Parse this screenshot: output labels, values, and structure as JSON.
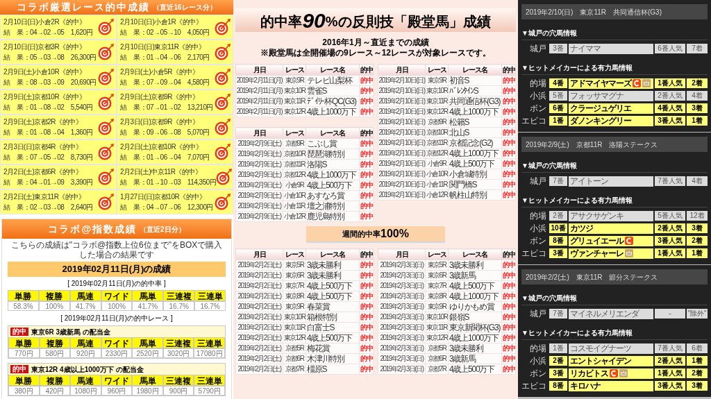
{
  "selected_races": {
    "title": "コラボ厳選レース的中成績",
    "note": "（直近16レース分）",
    "items": [
      {
        "title": "2月10日(日)小倉2R《的中》",
        "result": "結　果：04→02→05　1,620円"
      },
      {
        "title": "2月10日(日)小倉1R《的中》",
        "result": "結　果：02→05→10　4,050円"
      },
      {
        "title": "2月10日(日)京都3R《的中》",
        "result": "結　果：05→03→08　26,300円"
      },
      {
        "title": "2月10日(日)東京11R《的中》",
        "result": "結　果：01→04→06　2,170円"
      },
      {
        "title": "2月9日(土)小倉10R《的中》",
        "result": "結　果：08→03→09　20,690円"
      },
      {
        "title": "2月9日(土)小倉5R《的中》",
        "result": "結　果：07→09→04　4,580円"
      },
      {
        "title": "2月9日(土)京都10R《的中》",
        "result": "結　果：01→08→02　5,540円"
      },
      {
        "title": "2月9日(土)京都9R《的中》",
        "result": "結　果：07→01→02　13,210円"
      },
      {
        "title": "2月9日(土)京都2R《的中》",
        "result": "結　果：01→08→04　1,360円"
      },
      {
        "title": "2月3日(日)京都9R《的中》",
        "result": "結　果：09→06→08　5,070円"
      },
      {
        "title": "2月3日(日)京都4R《的中》",
        "result": "結　果：07→05→02　8,730円"
      },
      {
        "title": "2月2日(土)京都10R《的中》",
        "result": "結　果：01→06→04　7,070円"
      },
      {
        "title": "2月2日(土)京都6R《的中》",
        "result": "結　果：04→01→09　3,390円"
      },
      {
        "title": "2月2日(土)中京11R《的中》",
        "result": "結　果：01→10→03　114,350円"
      },
      {
        "title": "2月2日(土)東京11R《的中》",
        "result": "結　果：02→03→08　2,640円"
      },
      {
        "title": "1月27日(日)京都10R《的中》",
        "result": "結　果：04→07→06　12,300円"
      }
    ]
  },
  "index_results": {
    "title": "コラボ@指数成績",
    "note": "（直近2日分）",
    "description": "こちらの成績は\"コラボ@指数上位6位まで\"をBOXで購入した場合の結果です",
    "date_banner": "2019年02月11日(月)の成績",
    "rates_label": "[ 2019年02月11日(月)の的中率 ]",
    "columns": [
      "単勝",
      "複勝",
      "馬連",
      "ワイド",
      "馬単",
      "三連複",
      "三連単"
    ],
    "rates": [
      "58.3%",
      "100%",
      "41.7%",
      "100%",
      "41.7%",
      "16.7%",
      "16.7%"
    ],
    "races_label": "[ 2019年02月11日(月)の的中レース ]",
    "races": [
      {
        "badge": "的中",
        "title": "東京6R 3歳新馬 の配当金",
        "columns": [
          "単勝",
          "複勝",
          "馬連",
          "ワイド",
          "馬単",
          "三連複",
          "三連単"
        ],
        "values": [
          "770円",
          "580円",
          "920円",
          "2330円",
          "2520円",
          "3020円",
          "17080円"
        ]
      },
      {
        "badge": "的中",
        "title": "東京12R 4歳以上1000万下 の配当金",
        "columns": [
          "単勝",
          "複勝",
          "馬連",
          "ワイド",
          "馬単",
          "三連複",
          "三連単"
        ],
        "values": [
          "380円",
          "420円",
          "1080円",
          "960円",
          "1980円",
          "900円",
          "5790円"
        ]
      }
    ]
  },
  "hall_of_fame": {
    "title_before": "的中率",
    "title_number": "90",
    "title_after": "%の反則技「殿堂馬」成績",
    "subtitle": [
      "2016年1月～直近までの成績",
      "※殿堂馬は全開催場の9レース～12レースが対象レースです。"
    ],
    "top_columns": [
      {
        "tables": [
          {
            "columns": [
              "月日",
              "レース",
              "レース名",
              "的中"
            ],
            "rows": [
              [
                "2019年2月11日(月)",
                "東京9R",
                "テレビ山梨杯",
                "的中"
              ],
              [
                "2019年2月11日(月)",
                "東京10R",
                "雲雀S",
                "的中"
              ],
              [
                "2019年2月11日(月)",
                "東京11R",
                "ﾃﾞｲﾘｰ杯QC(G3)",
                "的中"
              ],
              [
                "2019年2月11日(月)",
                "東京12R",
                "4歳上1000万下",
                "的中"
              ]
            ]
          },
          {
            "columns": [
              "月日",
              "レース",
              "レース名",
              "的中"
            ],
            "rows": [
              [
                "2019年2月9日(土)",
                "京都9R",
                "こぶし賞",
                "的中"
              ],
              [
                "2019年2月9日(土)",
                "京都10R",
                "琵琶湖特別",
                "的中"
              ],
              [
                "2019年2月9日(土)",
                "京都11R",
                "洛陽S",
                "的中"
              ],
              [
                "2019年2月9日(土)",
                "京都12R",
                "4歳上1000万下",
                "的中"
              ],
              [
                "2019年2月9日(土)",
                "小倉9R",
                "4歳上500万下",
                "的中"
              ],
              [
                "2019年2月9日(土)",
                "小倉10R",
                "あすなろ賞",
                "的中"
              ],
              [
                "2019年2月9日(土)",
                "小倉11R",
                "壇之浦特別",
                "的中"
              ],
              [
                "2019年2月9日(土)",
                "小倉12R",
                "鹿児島特別",
                "的中"
              ]
            ]
          }
        ]
      },
      {
        "tables": [
          {
            "columns": [
              "月日",
              "レース",
              "レース名",
              "的中"
            ],
            "rows": [
              [
                "2019年2月10日(日)",
                "東京9R",
                "初音S",
                "的中"
              ],
              [
                "2019年2月10日(日)",
                "東京10R",
                "ﾊﾞﾚﾝﾀｲﾝS",
                "的中"
              ],
              [
                "2019年2月10日(日)",
                "東京11R",
                "共同通信杯(G3)",
                "的中"
              ],
              [
                "2019年2月10日(日)",
                "東京12R",
                "4歳上1000万下",
                "的中"
              ],
              [
                "2019年2月10日(日)",
                "京都9R",
                "松籟S",
                "的中"
              ],
              [
                "2019年2月10日(日)",
                "京都10R",
                "北山S",
                "的中"
              ],
              [
                "2019年2月10日(日)",
                "京都11R",
                "京都記念(G2)",
                "的中"
              ],
              [
                "2019年2月10日(日)",
                "京都12R",
                "4歳上1000万下",
                "的中"
              ],
              [
                "2019年2月10日(日)",
                "小倉9R",
                "4歳上500万下",
                "的中"
              ],
              [
                "2019年2月10日(日)",
                "小倉10R",
                "小倉城特別",
                "的中"
              ],
              [
                "2019年2月10日(日)",
                "小倉11R",
                "関門橋S",
                "的中"
              ],
              [
                "2019年2月10日(日)",
                "小倉12R",
                "帆柱山特別",
                "的中"
              ]
            ]
          }
        ]
      }
    ],
    "weekly_before": "週間的中率",
    "weekly_number": "100%",
    "bottom_tables": [
      {
        "columns": [
          "月日",
          "レース",
          "レース名",
          "的中"
        ],
        "rows": [
          [
            "2019年2月2日(土)",
            "東京5R",
            "3歳未勝利",
            "的中"
          ],
          [
            "2019年2月2日(土)",
            "東京6R",
            "3歳未勝利",
            "的中"
          ],
          [
            "2019年2月2日(土)",
            "東京7R",
            "4歳上500万下",
            "的中"
          ],
          [
            "2019年2月2日(土)",
            "東京8R",
            "4歳上500万下",
            "的中"
          ],
          [
            "2019年2月2日(土)",
            "東京9R",
            "春菜賞",
            "的中"
          ],
          [
            "2019年2月2日(土)",
            "東京10R",
            "箱根特別",
            "的中"
          ],
          [
            "2019年2月2日(土)",
            "東京11R",
            "白富士S",
            "的中"
          ],
          [
            "2019年2月2日(土)",
            "東京12R",
            "4歳上500万下",
            "的中"
          ],
          [
            "2019年2月2日(土)",
            "京都5R",
            "梅花賞",
            "的中"
          ],
          [
            "2019年2月2日(土)",
            "京都6R",
            "木津川特別",
            "的中"
          ],
          [
            "2019年2月2日(土)",
            "京都7R",
            "橿原S",
            "的中"
          ]
        ]
      },
      {
        "columns": [
          "月日",
          "レース",
          "レース名",
          "的中"
        ],
        "rows": [
          [
            "2019年2月3日(日)",
            "東京5R",
            "3歳未勝利",
            "的中"
          ],
          [
            "2019年2月3日(日)",
            "東京6R",
            "3歳新馬",
            "的中"
          ],
          [
            "2019年2月3日(日)",
            "東京7R",
            "4歳上500万下",
            "的中"
          ],
          [
            "2019年2月3日(日)",
            "東京8R",
            "4歳上1000万下",
            "的中"
          ],
          [
            "2019年2月3日(日)",
            "東京9R",
            "ゆりかもめ賞",
            "的中"
          ],
          [
            "2019年2月3日(日)",
            "東京10R",
            "銀嶺S",
            "的中"
          ],
          [
            "2019年2月3日(日)",
            "東京11R",
            "東京新聞杯(G3)",
            "的中"
          ],
          [
            "2019年2月3日(日)",
            "東京12R",
            "4歳上1000万下",
            "的中"
          ],
          [
            "2019年2月3日(日)",
            "京都5R",
            "3歳未勝利",
            "的中"
          ],
          [
            "2019年2月3日(日)",
            "京都6R",
            "3歳新馬",
            "的中"
          ],
          [
            "2019年2月3日(日)",
            "京都7R",
            "4歳上500万下",
            "的中"
          ]
        ]
      }
    ]
  },
  "race_panels": [
    {
      "header": [
        "2019年2/10(日)",
        "東京11R",
        "共同通信杯(G3)"
      ],
      "pick_label": "▼城戸の穴馬情報",
      "pick": {
        "label": "城戸",
        "number": "3番",
        "horse": "ナイママ",
        "popularity": "6番人気",
        "placing": "7着",
        "hit": false
      },
      "makers_label": "▼ヒットメイカーによる有力馬情報",
      "rows": [
        {
          "label": "的場",
          "number": "4番",
          "horse": "アドマイヤマーズ",
          "badges": [
            {
              "kind": "c"
            },
            {
              "kind": "crown"
            }
          ],
          "popularity": "1番人気",
          "placing": "2着",
          "hit": true
        },
        {
          "label": "小浜",
          "number": "5番",
          "horse": "フォッサマグナ",
          "popularity": "2番人気",
          "placing": "4着",
          "hit": false
        },
        {
          "label": "ボン",
          "number": "6番",
          "horse": "クラージュゲリエ",
          "popularity": "4番人気",
          "placing": "3着",
          "hit": true
        },
        {
          "label": "エビコ",
          "number": "1番",
          "horse": "ダノンキングリー",
          "popularity": "3番人気",
          "placing": "1着",
          "hit": true
        }
      ]
    },
    {
      "header": [
        "2019年2/9(土)",
        "京都11R",
        "洛陽ステークス"
      ],
      "pick_label": "▼城戸の穴馬情報",
      "pick": {
        "label": "城戸",
        "number": "7番",
        "horse": "アイトーン",
        "popularity": "7番人気",
        "placing": "4着",
        "hit": false
      },
      "makers_label": "▼ヒットメイカーによる有力馬情報",
      "rows": [
        {
          "label": "的場",
          "number": "2番",
          "horse": "アサクサゲンキ",
          "popularity": "5番人気",
          "placing": "12着",
          "hit": false
        },
        {
          "label": "小浜",
          "number": "10番",
          "horse": "カツジ",
          "popularity": "2番人気",
          "placing": "3着",
          "hit": true
        },
        {
          "label": "ボン",
          "number": "8番",
          "horse": "グリュイエール",
          "badges": [
            {
              "kind": "c"
            }
          ],
          "popularity": "3番人気",
          "placing": "2着",
          "hit": true
        },
        {
          "label": "エビコ",
          "number": "3番",
          "horse": "ヴァンチャーレ",
          "badges": [
            {
              "kind": "crown"
            }
          ],
          "popularity": "1番人気",
          "placing": "1着",
          "hit": true
        }
      ]
    },
    {
      "header": [
        "2019年2/2(土)",
        "東京11R",
        "節分ステークス"
      ],
      "pick_label": "▼城戸の穴馬情報",
      "pick": {
        "label": "城戸",
        "number": "7番",
        "horse": "マイネルメリエンダ",
        "popularity": "-",
        "placing": "\"除外\"",
        "hit": false
      },
      "makers_label": "▼ヒットメイカーによる有力馬情報",
      "rows": [
        {
          "label": "的場",
          "number": "1番",
          "horse": "コスモイグナーツ",
          "popularity": "7番人気",
          "placing": "6着",
          "hit": false
        },
        {
          "label": "小浜",
          "number": "2番",
          "horse": "エントシャイデン",
          "popularity": "2番人気",
          "placing": "1着",
          "hit": true
        },
        {
          "label": "ボン",
          "number": "3番",
          "horse": "リカビトス",
          "badges": [
            {
              "kind": "c"
            },
            {
              "kind": "crown"
            }
          ],
          "popularity": "1番人気",
          "placing": "2着",
          "hit": true
        },
        {
          "label": "エビコ",
          "number": "8番",
          "horse": "キロハナ",
          "popularity": "3番人気",
          "placing": "3着",
          "hit": true
        }
      ]
    }
  ]
}
